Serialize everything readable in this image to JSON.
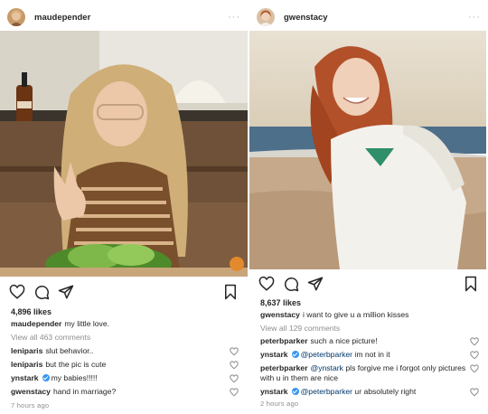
{
  "posts": [
    {
      "username": "maudepender",
      "more_icon": "more-dots-icon",
      "likes": "4,896 likes",
      "caption": {
        "user": "maudepender",
        "text": "my little love."
      },
      "view_all": "View all 463 comments",
      "comments": [
        {
          "user": "leniparis",
          "verified": false,
          "mention": "",
          "text": "slut behavior.."
        },
        {
          "user": "leniparis",
          "verified": false,
          "mention": "",
          "text": "but the pic is cute"
        },
        {
          "user": "ynstark",
          "verified": true,
          "mention": "",
          "text": "my babies!!!!!"
        },
        {
          "user": "gwenstacy",
          "verified": false,
          "mention": "",
          "text": "hand in marriage?"
        }
      ],
      "time": "7 hours ago"
    },
    {
      "username": "gwenstacy",
      "more_icon": "more-dots-icon",
      "likes": "8,637 likes",
      "caption": {
        "user": "gwenstacy",
        "text": "i want to give u a million kisses"
      },
      "view_all": "View all 129 comments",
      "comments": [
        {
          "user": "peterbparker",
          "verified": false,
          "mention": "",
          "text": "such a nice picture!"
        },
        {
          "user": "ynstark",
          "verified": true,
          "mention": "@peterbparker",
          "text": "im not in it"
        },
        {
          "user": "peterbparker",
          "verified": false,
          "mention": "@ynstark",
          "text": "pls forgive me i forgot only pictures with u in them are nice"
        },
        {
          "user": "ynstark",
          "verified": true,
          "mention": "@peterbparker",
          "text": "ur absolutely right"
        }
      ],
      "time": "2 hours ago"
    }
  ],
  "icons": [
    "heart-icon",
    "comment-icon",
    "share-icon",
    "bookmark-icon",
    "more-dots-icon"
  ],
  "colors": {
    "text": "#262626",
    "muted": "#8e8e8e",
    "mention": "#00376b",
    "verified": "#3897f0"
  }
}
